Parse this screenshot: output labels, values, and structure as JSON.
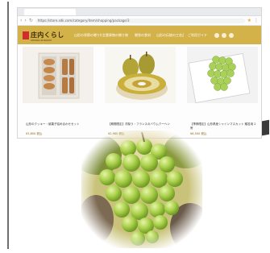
{
  "browser": {
    "url": "https://store.sdk.com/category/item/shopping/package/3",
    "tab_title": ""
  },
  "site": {
    "logo_text": "庄内くらし",
    "logo_subtitle": "SHONAI KURASHI",
    "nav": [
      "山形の季節の贈り物",
      "定番果物の贈り物",
      "贈答の食材",
      "山形の伝統の工芸品",
      "ご利用ガイド"
    ],
    "colors": {
      "header": "#d4b24a",
      "logo_accent": "#d12b2b"
    }
  },
  "products": [
    {
      "name": "山形のクッキー・焼菓子詰め合わせセット",
      "price": "¥3,800 税込"
    },
    {
      "name": "【期間限定】洋梨ラ・フランスのバウムクーヘン",
      "price": "¥2,980 税込"
    },
    {
      "name": "【季節限定】山形県産シャインマスカット 贈答用 2房",
      "price": "¥6,500 税込"
    }
  ],
  "icons": [
    "back-arrow-icon",
    "forward-arrow-icon",
    "reload-icon",
    "bookmark-star-icon",
    "menu-dots-icon",
    "search-icon",
    "cart-icon",
    "account-icon"
  ]
}
